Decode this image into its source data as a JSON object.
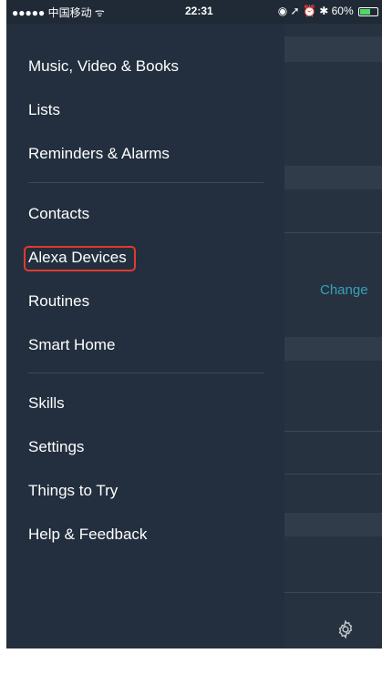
{
  "status_bar": {
    "signal_carrier": "●●●●● 中国移动",
    "wifi_icon": "wifi-icon",
    "time": "22:31",
    "right_icons": "◉ ➚ ⏰ ✱",
    "battery_percent": "60%"
  },
  "menu": {
    "items": [
      {
        "label": "Music, Video & Books"
      },
      {
        "label": "Lists"
      },
      {
        "label": "Reminders & Alarms"
      },
      {
        "label": "Contacts"
      },
      {
        "label": "Alexa Devices"
      },
      {
        "label": "Routines"
      },
      {
        "label": "Smart Home"
      },
      {
        "label": "Skills"
      },
      {
        "label": "Settings"
      },
      {
        "label": "Things to Try"
      },
      {
        "label": "Help & Feedback"
      }
    ]
  },
  "background": {
    "change_label": "Change",
    "gear_icon": "gear-icon"
  },
  "colors": {
    "menu_bg": "#232f3e",
    "highlight": "#e03b2c",
    "link": "#3aa0b9"
  }
}
